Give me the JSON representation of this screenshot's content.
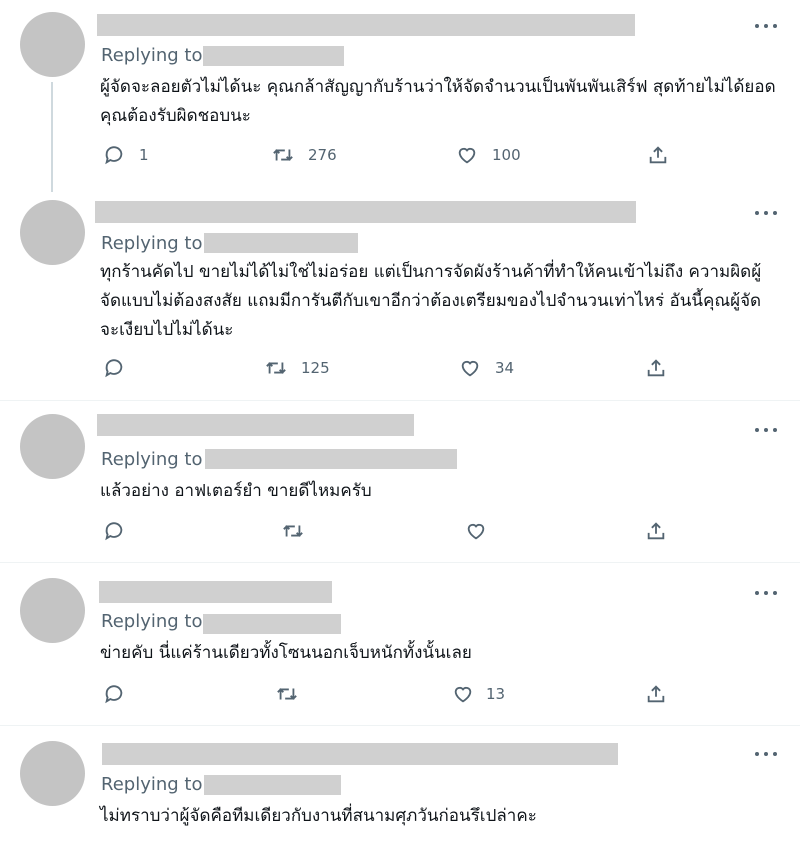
{
  "thread": {
    "replies": [
      {
        "replying_label": "Replying to",
        "text": "ผู้จัดจะลอยตัวไม่ได้นะ คุณกล้าสัญญากับร้านว่าให้จัดจำนวนเป็นพันพันเสิร์ฟ สุดท้ายไม่ได้ยอด คุณต้องรับผิดชอบนะ",
        "replies_count": "1",
        "retweets_count": "276",
        "likes_count": "100"
      },
      {
        "replying_label": "Replying to",
        "text": "ทุกร้านคัดไป ขายไม่ได้ไม่ใช่ไม่อร่อย แต่เป็นการจัดผังร้านค้าที่ทำให้คนเข้าไม่ถึง ความผิดผู้จัดแบบไม่ต้องสงสัย แถมมีการันตีกับเขาอีกว่าต้องเตรียมของไปจำนวนเท่าไหร่ อันนี้คุณผู้จัดจะเงียบไปไม่ได้นะ",
        "replies_count": "",
        "retweets_count": "125",
        "likes_count": "34"
      },
      {
        "replying_label": "Replying to",
        "text": "แล้วอย่าง อาฟเตอร์ยำ ขายดีไหมครับ",
        "replies_count": "",
        "retweets_count": "",
        "likes_count": ""
      },
      {
        "replying_label": "Replying to",
        "text": "ข่ายคับ นี่แค่ร้านเดียวทั้งโซนนอกเจ็บหนักทั้งนั้นเลย",
        "replies_count": "",
        "retweets_count": "",
        "likes_count": "13"
      },
      {
        "replying_label": "Replying to",
        "text": "ไม่ทราบว่าผู้จัดคือทีมเดียวกับงานที่สนามศุภวันก่อนรึเปล่าคะ"
      }
    ]
  },
  "icons": {
    "reply": "reply-icon",
    "retweet": "retweet-icon",
    "like": "heart-icon",
    "share": "share-icon",
    "more": "more-icon"
  },
  "colors": {
    "icon": "#536471",
    "redaction": "#d0d0d0",
    "avatar": "#c4c4c4",
    "divider": "#eff3f4"
  }
}
